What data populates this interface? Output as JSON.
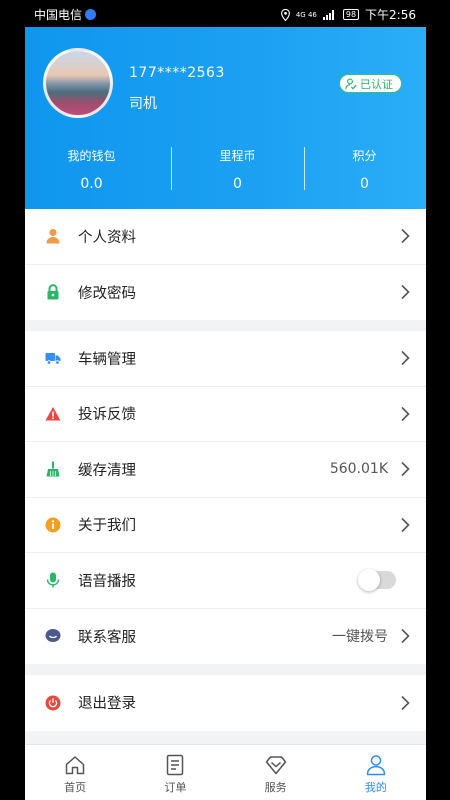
{
  "status_bar": {
    "carrier": "中国电信",
    "network": "4G 46",
    "battery": "98",
    "time": "下午2:56"
  },
  "profile": {
    "phone": "177****2563",
    "role": "司机",
    "verified_label": "已认证"
  },
  "stats": [
    {
      "label": "我的钱包",
      "value": "0.0"
    },
    {
      "label": "里程币",
      "value": "0"
    },
    {
      "label": "积分",
      "value": "0"
    }
  ],
  "menu": {
    "personal_info": {
      "label": "个人资料",
      "icon": "person-icon",
      "color": "#f19a4a"
    },
    "change_password": {
      "label": "修改密码",
      "icon": "lock-icon",
      "color": "#27b767"
    },
    "vehicle": {
      "label": "车辆管理",
      "icon": "truck-icon",
      "color": "#3a8ef0"
    },
    "complaint": {
      "label": "投诉反馈",
      "icon": "warning-icon",
      "color": "#e8483d"
    },
    "cache": {
      "label": "缓存清理",
      "value": "560.01K",
      "icon": "broom-icon",
      "color": "#27b767"
    },
    "about": {
      "label": "关于我们",
      "icon": "info-icon",
      "color": "#f3a020"
    },
    "voice": {
      "label": "语音播报",
      "icon": "microphone-icon",
      "color": "#27b767",
      "enabled": false
    },
    "support": {
      "label": "联系客服",
      "value": "一键拨号",
      "icon": "chat-icon",
      "color": "#4a5a8c"
    },
    "logout": {
      "label": "退出登录",
      "icon": "power-icon",
      "color": "#e8483d"
    }
  },
  "tabs": [
    {
      "label": "首页",
      "icon": "home-icon"
    },
    {
      "label": "订单",
      "icon": "document-icon"
    },
    {
      "label": "服务",
      "icon": "diamond-icon"
    },
    {
      "label": "我的",
      "icon": "user-icon",
      "active": true
    }
  ],
  "colors": {
    "header": "#1ba0f2",
    "accent": "#2f8df4"
  }
}
